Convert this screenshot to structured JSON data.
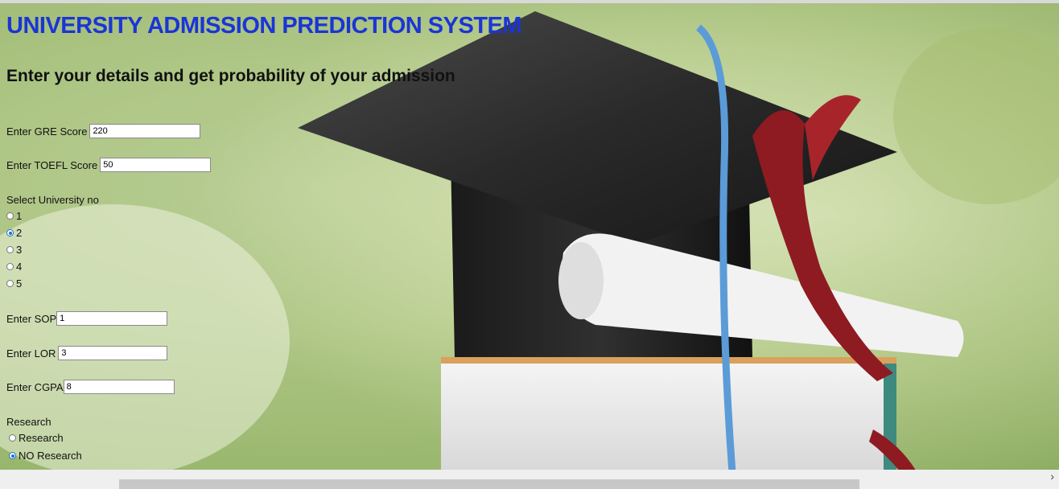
{
  "page": {
    "title": "UNIVERSITY ADMISSION PREDICTION SYSTEM",
    "subtitle": "Enter your details and get probability of your admission"
  },
  "form": {
    "gre": {
      "label": "Enter GRE Score",
      "value": "220"
    },
    "toefl": {
      "label": "Enter TOEFL Score",
      "value": "50"
    },
    "university": {
      "label": "Select University no",
      "options": [
        "1",
        "2",
        "3",
        "4",
        "5"
      ],
      "selected": "2"
    },
    "sop": {
      "label": "Enter SOP",
      "value": "1"
    },
    "lor": {
      "label": "Enter LOR",
      "value": "3"
    },
    "cgpa": {
      "label": "Enter CGPA",
      "value": "8"
    },
    "research": {
      "label": "Research",
      "options": [
        "Research",
        "NO Research"
      ],
      "selected": "NO Research"
    }
  },
  "scrollbar": {
    "arrow": "›"
  },
  "colors": {
    "title": "#1a35d6",
    "radio_accent": "#1f6fd1"
  }
}
